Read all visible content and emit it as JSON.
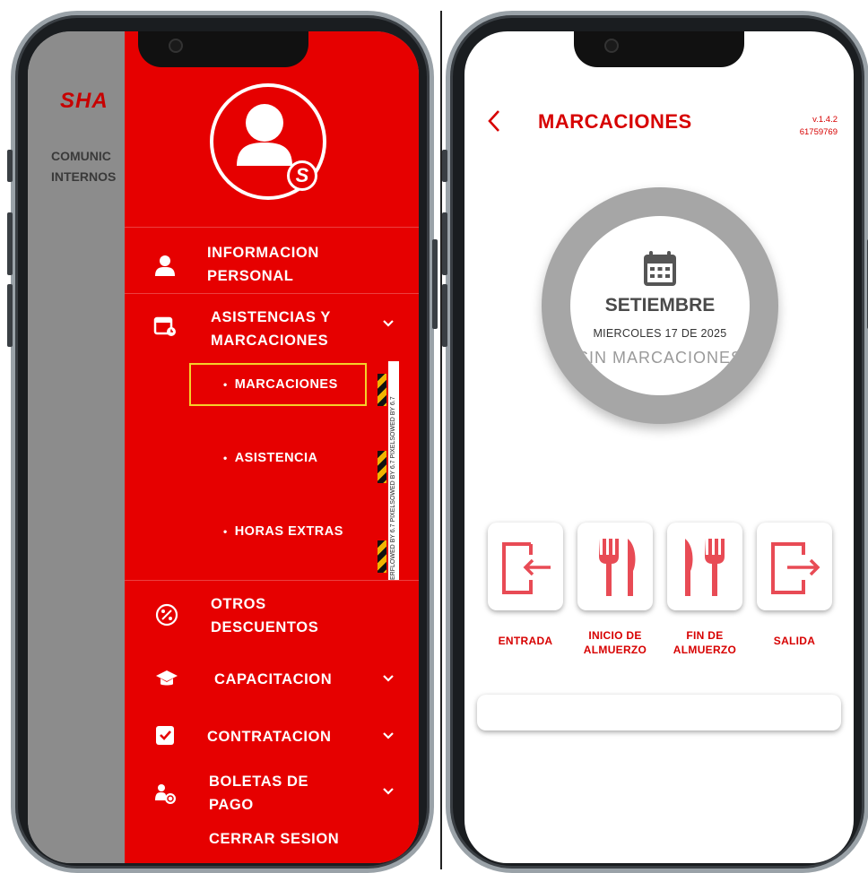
{
  "left_phone": {
    "background_app": {
      "brand": "SHA",
      "section_text": "COMUNIC\nINTERNOS"
    },
    "drawer": {
      "menu": [
        {
          "label": "INFORMACION\nPERSONAL",
          "icon": "person-icon"
        },
        {
          "label": "ASISTENCIAS Y\nMARCACIONES",
          "icon": "calendar-clock-icon",
          "expanded": true
        },
        {
          "label": "OTROS\nDESCUENTOS",
          "icon": "percent-icon"
        },
        {
          "label": "CAPACITACION",
          "icon": "graduation-cap-icon"
        },
        {
          "label": "CONTRATACION",
          "icon": "clipboard-check-icon"
        },
        {
          "label": "BOLETAS DE\nPAGO",
          "icon": "person-coin-icon"
        }
      ],
      "submenu": [
        "MARCACIONES",
        "ASISTENCIA",
        "HORAS EXTRAS"
      ],
      "selected_submenu": "MARCACIONES",
      "logout_label": "CERRAR SESION",
      "avatar_badge": "S",
      "watermark_text": "ERFLOWED BY 6.7 PIXELSOWED BY 6.7 PIXELSOWED BY 6.7"
    }
  },
  "right_phone": {
    "header": {
      "title": "MARCACIONES",
      "version": "v.1.4.2",
      "id_number": "61759769"
    },
    "date_card": {
      "month": "SETIEMBRE",
      "date": "MIERCOLES 17 DE 2025",
      "status": "SIN MARCACIONES"
    },
    "actions": [
      {
        "label": "ENTRADA",
        "icon": "login-arrow-icon"
      },
      {
        "label": "INICIO DE\nALMUERZO",
        "icon": "fork-knife-icon"
      },
      {
        "label": "FIN DE\nALMUERZO",
        "icon": "knife-fork-icon"
      },
      {
        "label": "SALIDA",
        "icon": "logout-arrow-icon"
      }
    ]
  },
  "colors": {
    "brand_red": "#e60000",
    "text_red": "#d70000",
    "icon_red": "#e84b55",
    "highlight_yellow": "#f5d12a",
    "ring_gray": "#a6a6a6"
  }
}
